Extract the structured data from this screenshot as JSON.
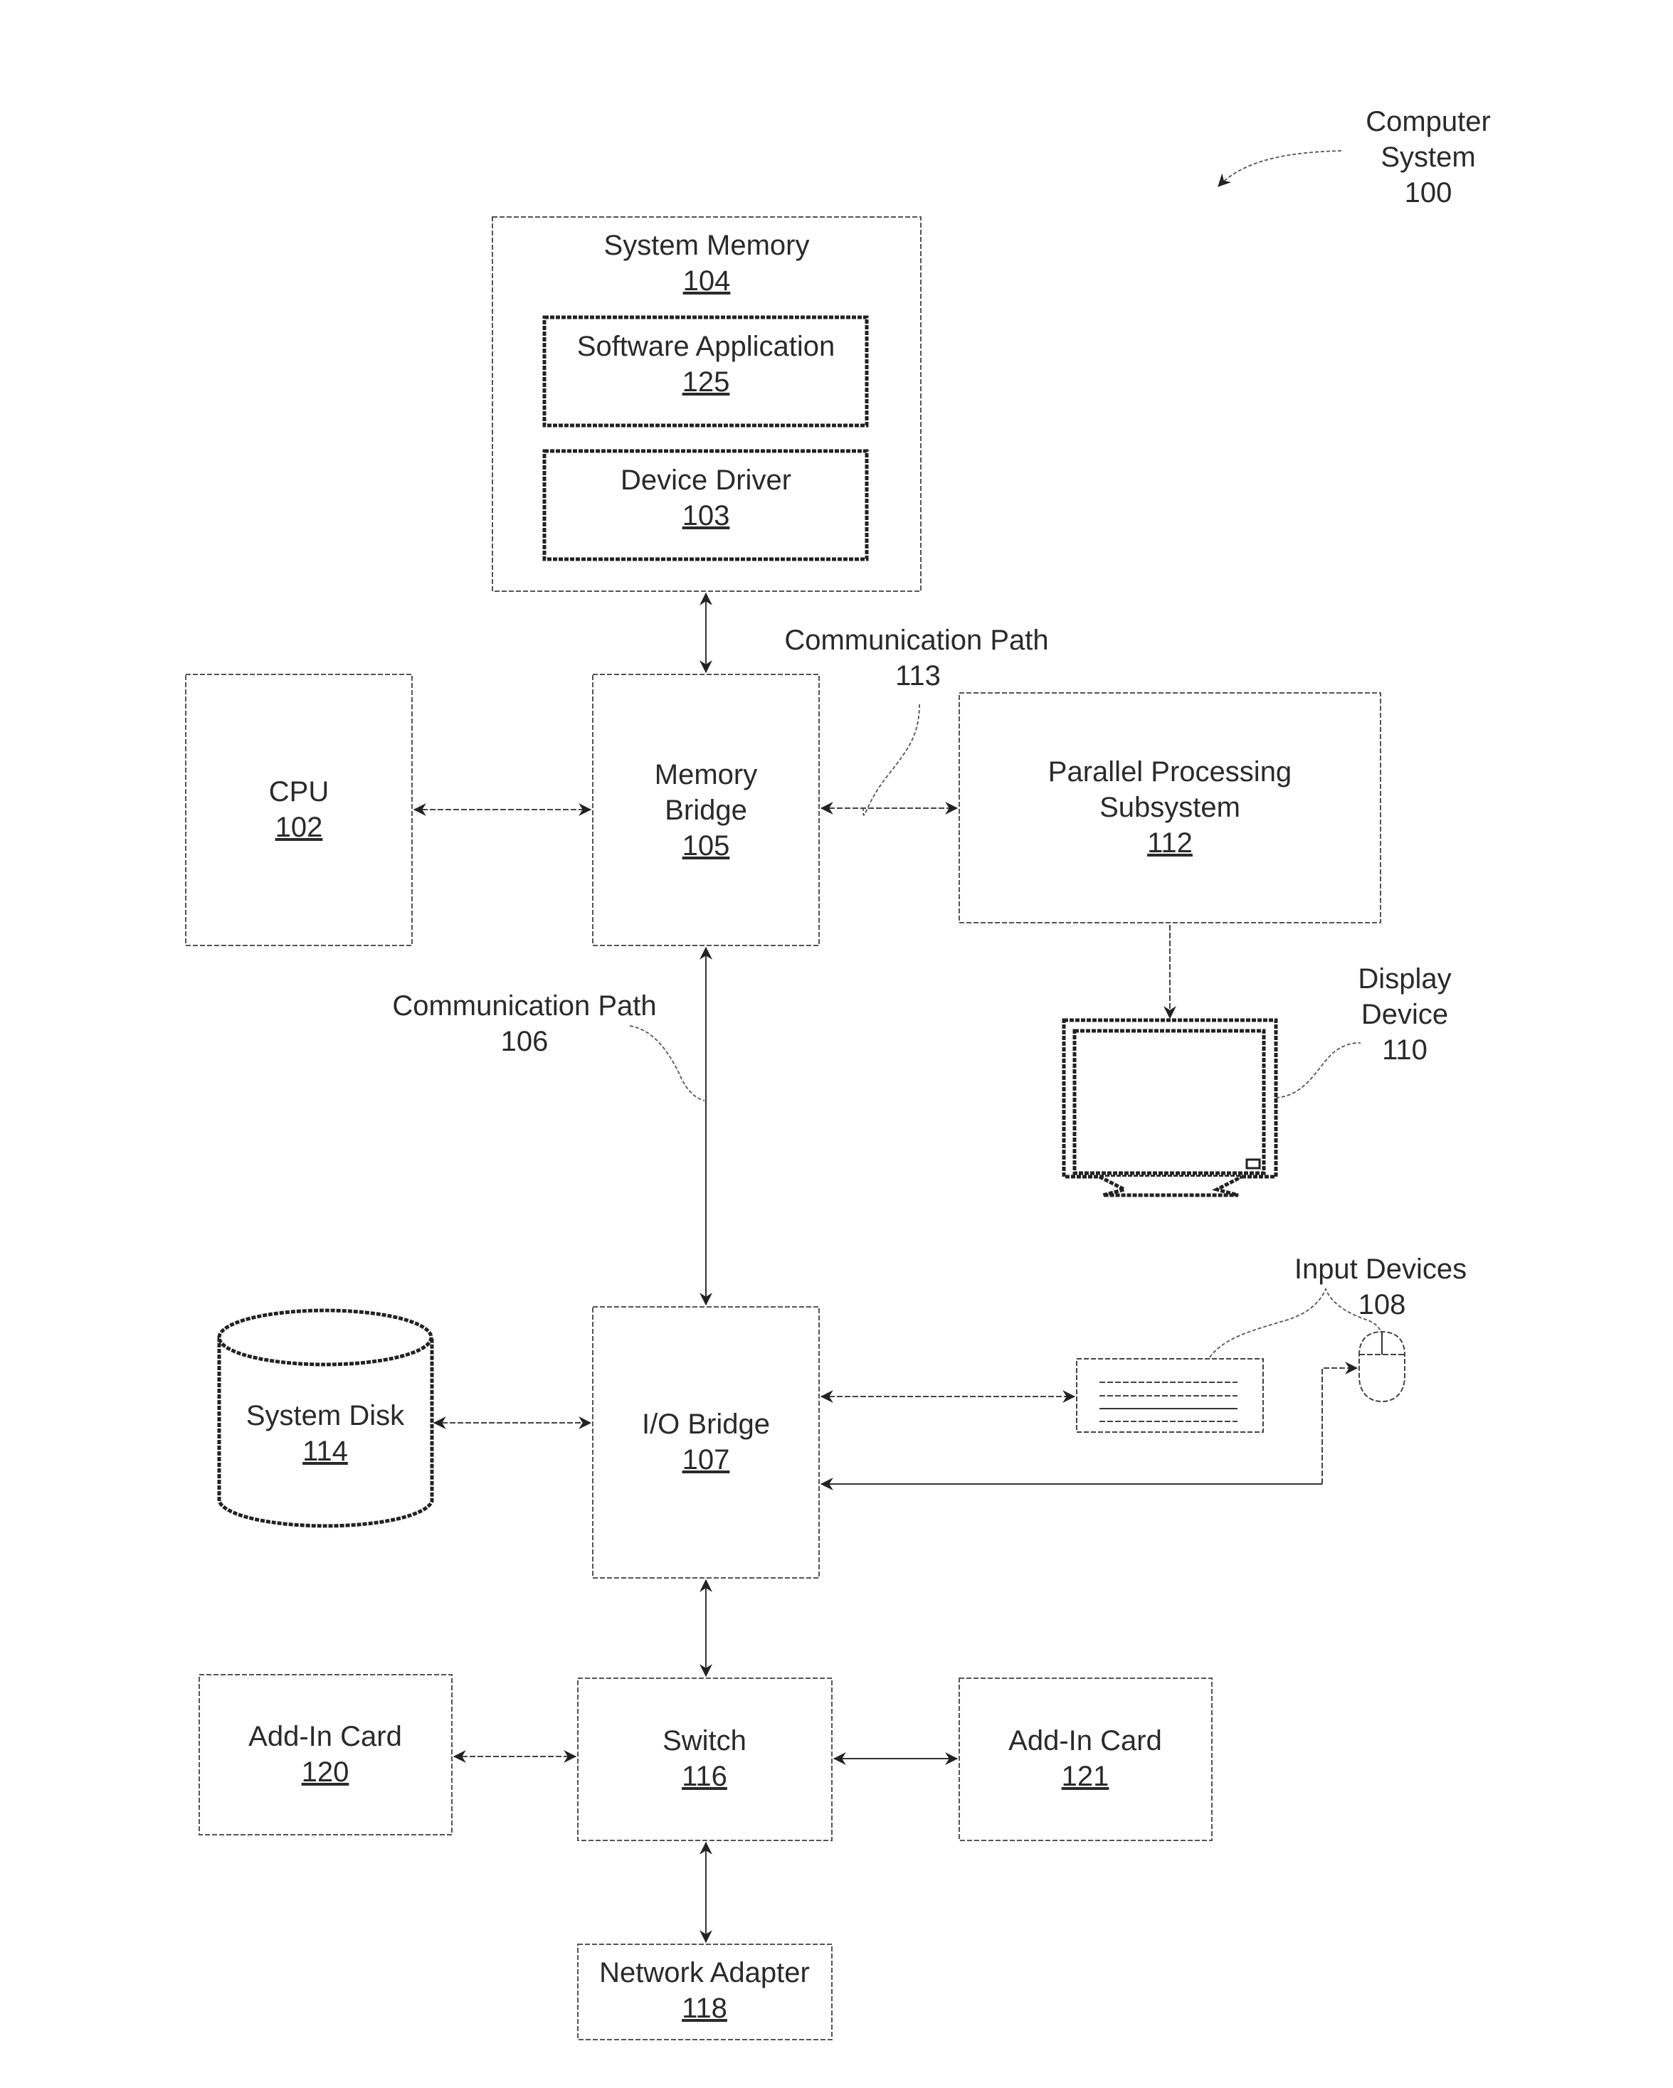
{
  "figure": {
    "title_label": {
      "line1": "Computer",
      "line2": "System",
      "ref": "100"
    }
  },
  "components": {
    "system_memory": {
      "name": "System Memory",
      "ref": "104"
    },
    "software_application": {
      "name": "Software Application",
      "ref": "125"
    },
    "device_driver": {
      "name": "Device Driver",
      "ref": "103"
    },
    "cpu": {
      "name": "CPU",
      "ref": "102"
    },
    "memory_bridge": {
      "line1": "Memory",
      "line2": "Bridge",
      "ref": "105"
    },
    "parallel_processing_subsystem": {
      "line1": "Parallel Processing",
      "line2": "Subsystem",
      "ref": "112"
    },
    "display_device": {
      "line1": "Display",
      "line2": "Device",
      "ref": "110"
    },
    "io_bridge": {
      "name": "I/O Bridge",
      "ref": "107"
    },
    "system_disk": {
      "name": "System Disk",
      "ref": "114"
    },
    "input_devices": {
      "name": "Input Devices",
      "ref": "108"
    },
    "switch": {
      "name": "Switch",
      "ref": "116"
    },
    "add_in_card_120": {
      "name": "Add-In Card",
      "ref": "120"
    },
    "add_in_card_121": {
      "name": "Add-In Card",
      "ref": "121"
    },
    "network_adapter": {
      "name": "Network Adapter",
      "ref": "118"
    }
  },
  "paths": {
    "communication_path_113": {
      "name": "Communication Path",
      "ref": "113"
    },
    "communication_path_106": {
      "name": "Communication Path",
      "ref": "106"
    }
  },
  "connections": [
    {
      "from": "System Memory",
      "to": "Memory Bridge",
      "direction": "bidirectional"
    },
    {
      "from": "CPU",
      "to": "Memory Bridge",
      "direction": "bidirectional"
    },
    {
      "from": "Memory Bridge",
      "to": "Parallel Processing Subsystem",
      "direction": "bidirectional",
      "via": "Communication Path 113"
    },
    {
      "from": "Parallel Processing Subsystem",
      "to": "Display Device",
      "direction": "one-way"
    },
    {
      "from": "Memory Bridge",
      "to": "I/O Bridge",
      "direction": "bidirectional",
      "via": "Communication Path 106"
    },
    {
      "from": "System Disk",
      "to": "I/O Bridge",
      "direction": "bidirectional"
    },
    {
      "from": "I/O Bridge",
      "to": "Keyboard",
      "direction": "bidirectional"
    },
    {
      "from": "Mouse",
      "to": "I/O Bridge",
      "direction": "bidirectional"
    },
    {
      "from": "I/O Bridge",
      "to": "Switch",
      "direction": "bidirectional"
    },
    {
      "from": "Add-In Card 120",
      "to": "Switch",
      "direction": "bidirectional"
    },
    {
      "from": "Switch",
      "to": "Add-In Card 121",
      "direction": "bidirectional"
    },
    {
      "from": "Switch",
      "to": "Network Adapter",
      "direction": "bidirectional"
    }
  ]
}
